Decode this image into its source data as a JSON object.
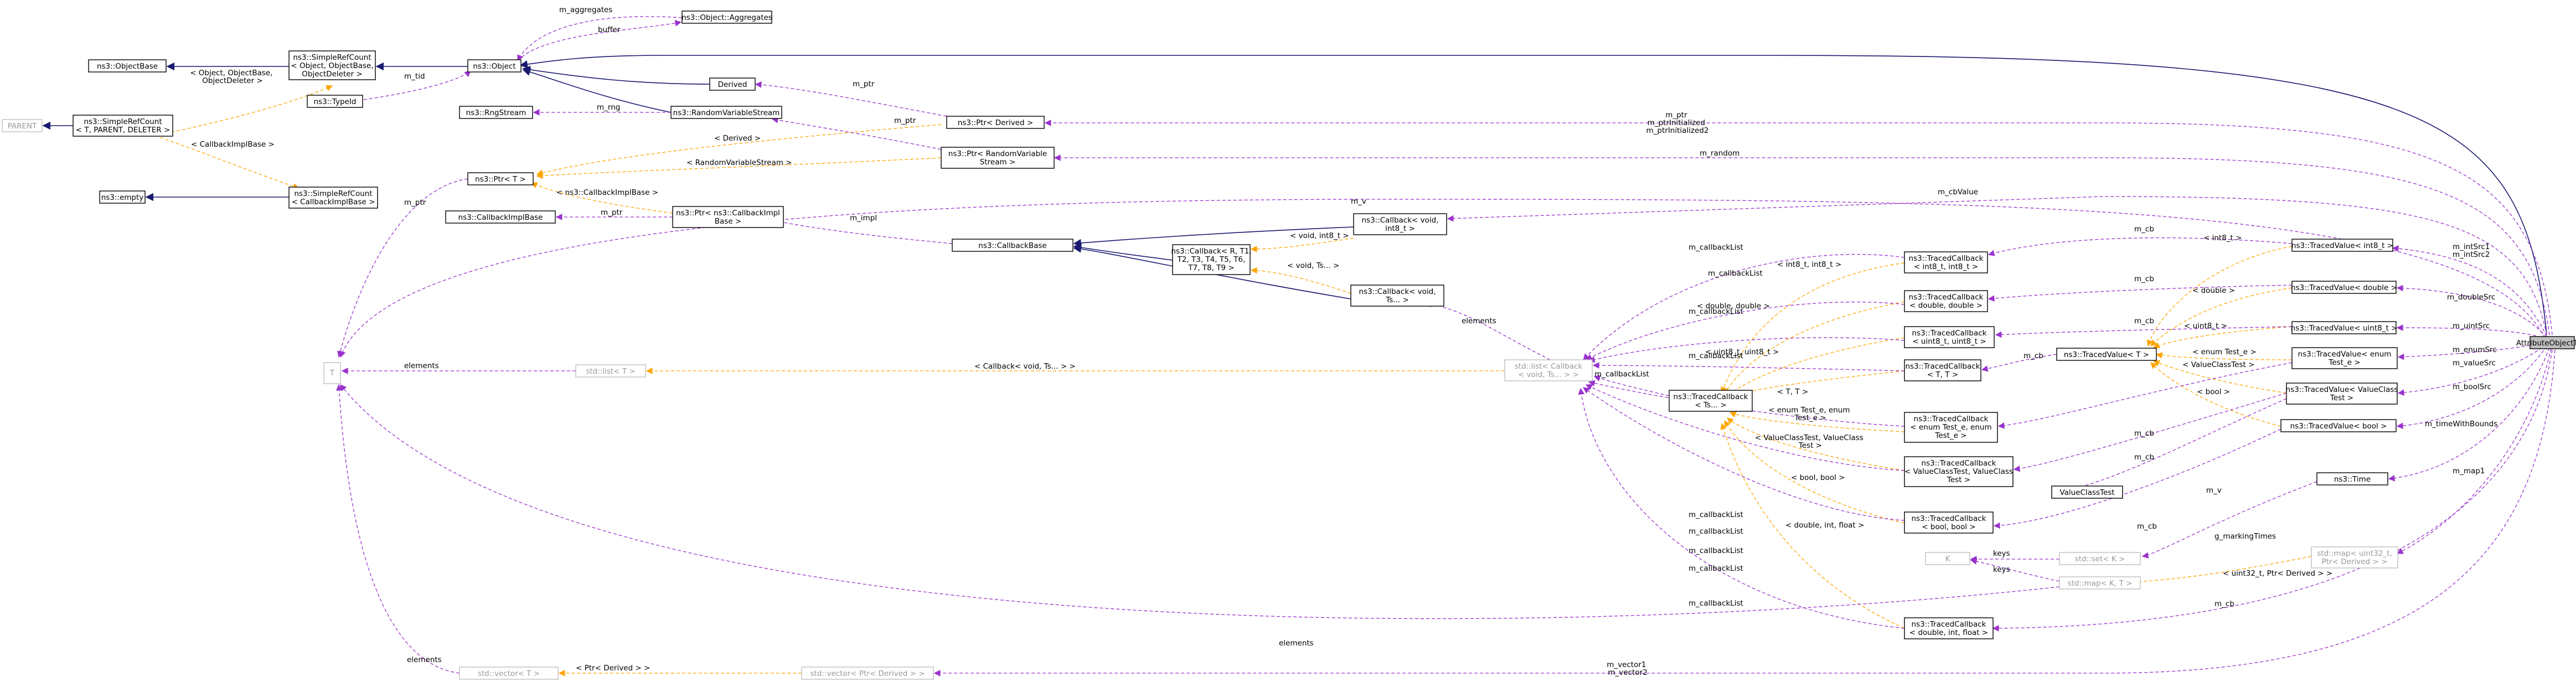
{
  "colors": {
    "usage_edge": "#9a32cd",
    "template_edge": "#ffa500",
    "inheritance_edge": "#191970",
    "main_node_fill": "#bfbfbf",
    "external_node_border": "#bfbfbf"
  },
  "nodes": {
    "attribute_object_test": "AttributeObjectTest",
    "object": "ns3::Object",
    "object_aggregates": "ns3::Object::Aggregates",
    "object_base": "ns3::ObjectBase",
    "simple_ref_count_object": [
      "ns3::SimpleRefCount",
      "< Object, ObjectBase,",
      "ObjectDeleter >"
    ],
    "type_id": "ns3::TypeId",
    "parent": "PARENT",
    "simple_ref_count_generic": [
      "ns3::SimpleRefCount",
      "< T, PARENT, DELETER >"
    ],
    "empty": "ns3::empty",
    "simple_ref_count_callback": [
      "ns3::SimpleRefCount",
      "< CallbackImplBase >"
    ],
    "callback_impl_base": "ns3::CallbackImplBase",
    "rng_stream": "ns3::RngStream",
    "random_variable_stream": "ns3::RandomVariableStream",
    "derived": "Derived",
    "ptr_derived": "ns3::Ptr< Derived >",
    "ptr_random": [
      "ns3::Ptr< RandomVariable",
      "Stream >"
    ],
    "ptr_t": "ns3::Ptr< T >",
    "ptr_callback_impl": [
      "ns3::Ptr< ns3::CallbackImpl",
      "Base >"
    ],
    "callback_base": "ns3::CallbackBase",
    "callback_void_int8": [
      "ns3::Callback< void,",
      "int8_t >"
    ],
    "callback_many": [
      "ns3::Callback< R, T1,",
      "T2, T3, T4, T5, T6,",
      "T7, T8, T9 >"
    ],
    "callback_void_ts": [
      "ns3::Callback< void,",
      "Ts... >"
    ],
    "t": "T",
    "std_list_t": "std::list< T >",
    "std_list_callback": [
      "std::list< Callback",
      "< void, Ts... > >"
    ],
    "traced_callback_ts": [
      "ns3::TracedCallback",
      "< Ts... >"
    ],
    "traced_callback_int8": [
      "ns3::TracedCallback",
      "< int8_t, int8_t >"
    ],
    "traced_callback_double": [
      "ns3::TracedCallback",
      "< double, double >"
    ],
    "traced_callback_uint8": [
      "ns3::TracedCallback",
      "< uint8_t, uint8_t >"
    ],
    "traced_callback_tt": [
      "ns3::TracedCallback",
      "< T, T >"
    ],
    "traced_callback_enum": [
      "ns3::TracedCallback",
      "< enum Test_e, enum",
      "Test_e >"
    ],
    "traced_callback_valueclass": [
      "ns3::TracedCallback",
      "< ValueClassTest, ValueClass",
      "Test >"
    ],
    "traced_callback_bool": [
      "ns3::TracedCallback",
      "< bool, bool >"
    ],
    "traced_callback_dif": [
      "ns3::TracedCallback",
      "< double, int, float >"
    ],
    "traced_value_t": "ns3::TracedValue< T >",
    "traced_value_int8": "ns3::TracedValue< int8_t >",
    "traced_value_double": "ns3::TracedValue< double >",
    "traced_value_uint8": "ns3::TracedValue< uint8_t >",
    "traced_value_enum": [
      "ns3::TracedValue< enum",
      "Test_e >"
    ],
    "traced_value_valueclass": [
      "ns3::TracedValue< ValueClass",
      "Test >"
    ],
    "traced_value_bool": "ns3::TracedValue< bool >",
    "value_class_test": "ValueClassTest",
    "time": "ns3::Time",
    "k": "K",
    "std_set_k": "std::set< K >",
    "std_map_kt": "std::map< K, T >",
    "std_map_uint32": [
      "std::map< uint32_t,",
      "Ptr< Derived > >"
    ],
    "std_vector_t": "std::vector< T >",
    "std_vector_ptr": "std::vector< Ptr< Derived > >"
  },
  "edge_labels": {
    "aggregates": "m_aggregates",
    "buffer": "buffer",
    "tid": "m_tid",
    "object_tpl": [
      "< Object, ObjectBase,",
      "ObjectDeleter >"
    ],
    "callback_impl_tpl": "< CallbackImplBase >",
    "rng": "m_rng",
    "ptr_derived_member": "m_ptr",
    "ptr_random_member": "m_ptr",
    "ptr_callback_member": "m_ptr",
    "ptr_t_member": "m_ptr",
    "derived_tpl": "< Derived >",
    "random_tpl": "< RandomVariableStream >",
    "callbackimpl_tpl": "< ns3::CallbackImplBase >",
    "impl": "m_impl",
    "ptr_main": [
      "m_ptr",
      "m_ptrInitialized",
      "m_ptrInitialized2"
    ],
    "random_main": "m_random",
    "cbvalue": "m_cbValue",
    "v": "m_v",
    "elements": "elements",
    "void_int8_tpl": "< void, int8_t >",
    "void_ts_tpl": "< void, Ts... >",
    "callback_void_tpl": "< Callback< void, Ts... > >",
    "callback_list": "m_callbackList",
    "int8_tpl": "< int8_t, int8_t >",
    "double_double_tpl": "< double, double >",
    "uint8_tpl": "< uint8_t, uint8_t >",
    "tt_tpl": "< T, T >",
    "enum_tpl": [
      "< enum Test_e, enum",
      "Test_e >"
    ],
    "valueclass_tpl": [
      "< ValueClassTest, ValueClass",
      "Test >"
    ],
    "bool_tpl": "< bool, bool >",
    "dif_tpl": "< double, int, float >",
    "cb": "m_cb",
    "int8_t_tpl": "< int8_t >",
    "double_tpl": "< double >",
    "uint8_t_tpl": "< uint8_t >",
    "enum_test_tpl": "< enum Test_e >",
    "valueclasstest_tpl": "< ValueClassTest >",
    "bool_only_tpl": "< bool >",
    "int_src": [
      "m_intSrc1",
      "m_intSrc2"
    ],
    "double_src": "m_doubleSrc",
    "uint_src": "m_uintSrc",
    "enum_src": "m_enumSrc",
    "value_src": "m_valueSrc",
    "bool_src": "m_boolSrc",
    "time_with_bounds": "m_timeWithBounds",
    "marking_times": "g_markingTimes",
    "keys": "keys",
    "map1": "m_map1",
    "uint32_ptr_tpl": "< uint32_t, Ptr< Derived > >",
    "ptr_derived_tpl": "< Ptr< Derived > >",
    "vectors": [
      "m_vector1",
      "m_vector2"
    ]
  }
}
